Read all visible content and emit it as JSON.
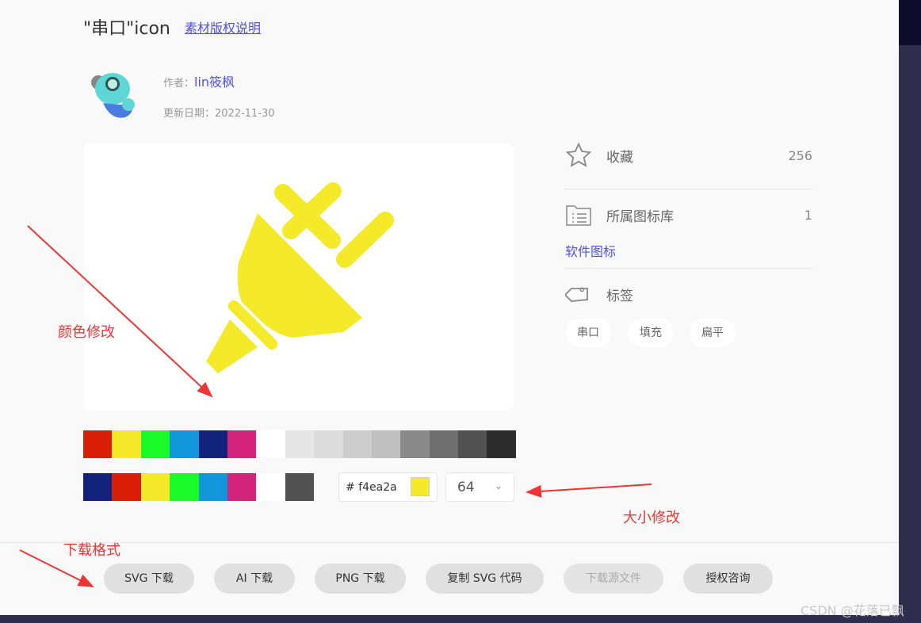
{
  "header": {
    "title": "\"串口\"icon",
    "copyright_link": "素材版权说明"
  },
  "author": {
    "label": "作者：",
    "name": "lin筱枫",
    "date_label": "更新日期：",
    "date": "2022-11-30"
  },
  "icon_color": "#f4ea2a",
  "palette_row1": [
    "#d81e06",
    "#f4ea2a",
    "#1afa29",
    "#1296db",
    "#13227a",
    "#d4237a",
    "#ffffff",
    "#e6e6e6",
    "#dbdbdb",
    "#cdcdcd",
    "#bfbfbf",
    "#8a8a8a",
    "#707070",
    "#515151",
    "#2c2c2c"
  ],
  "palette_row2": [
    "#13227a",
    "#d81e06",
    "#f4ea2a",
    "#1afa29",
    "#1296db",
    "#d4237a",
    "#ffffff",
    "#515151"
  ],
  "color_input": {
    "hash": "#",
    "value": "f4ea2a"
  },
  "size_select": {
    "value": "64"
  },
  "sidebar": {
    "favorite_label": "收藏",
    "favorite_count": "256",
    "library_label": "所属图标库",
    "library_count": "1",
    "library_name": "软件图标",
    "tags_label": "标签",
    "tags": [
      "串口",
      "填充",
      "扁平"
    ]
  },
  "buttons": [
    "SVG 下载",
    "AI 下载",
    "PNG 下载",
    "复制 SVG 代码",
    "下载源文件",
    "授权咨询"
  ],
  "annotations": {
    "color": "颜色修改",
    "size": "大小修改",
    "format": "下载格式"
  },
  "watermark": "CSDN @花落已飘"
}
